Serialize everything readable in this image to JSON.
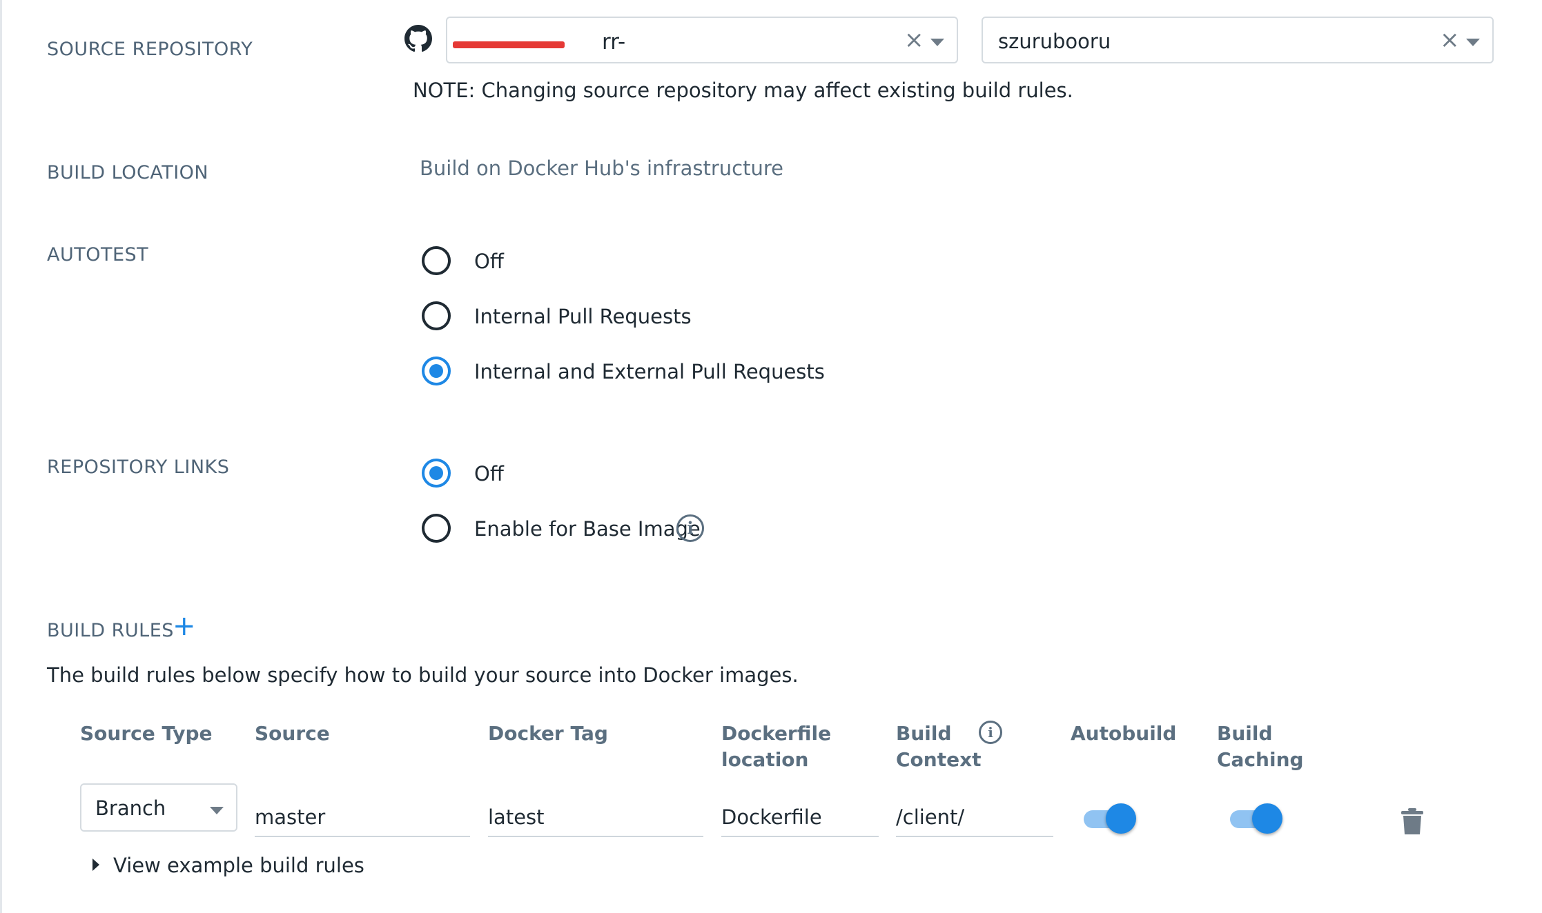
{
  "source_repository": {
    "label": "SOURCE REPOSITORY",
    "org_value": "rr-",
    "repo_value": "szurubooru",
    "clear_glyph": "×",
    "note": "NOTE: Changing source repository may affect existing build rules.",
    "icon": "github-icon"
  },
  "build_location": {
    "label": "BUILD LOCATION",
    "value": "Build on Docker Hub's infrastructure"
  },
  "autotest": {
    "label": "AUTOTEST",
    "options": [
      {
        "label": "Off",
        "checked": false
      },
      {
        "label": "Internal Pull Requests",
        "checked": false
      },
      {
        "label": "Internal and External Pull Requests",
        "checked": true
      }
    ]
  },
  "repository_links": {
    "label": "REPOSITORY LINKS",
    "options": [
      {
        "label": "Off",
        "checked": true
      },
      {
        "label": "Enable for Base Image",
        "checked": false
      }
    ]
  },
  "build_rules": {
    "label": "BUILD RULES",
    "add_glyph": "+",
    "description": "The build rules below specify how to build your source into Docker images.",
    "columns": {
      "source_type": "Source Type",
      "source": "Source",
      "docker_tag": "Docker Tag",
      "dockerfile_location_1": "Dockerfile",
      "dockerfile_location_2": "location",
      "build_context_1": "Build",
      "build_context_2": "Context",
      "autobuild": "Autobuild",
      "build_caching_1": "Build",
      "build_caching_2": "Caching"
    },
    "rows": [
      {
        "source_type": "Branch",
        "source": "master",
        "docker_tag": "latest",
        "dockerfile_location": "Dockerfile",
        "build_context": "/client/",
        "autobuild": true,
        "build_caching": true
      }
    ],
    "view_examples": "View example build rules"
  },
  "colors": {
    "accent": "#1e88e5",
    "label": "#4f6477",
    "text": "#1f2a33",
    "redaction": "#e53935"
  }
}
